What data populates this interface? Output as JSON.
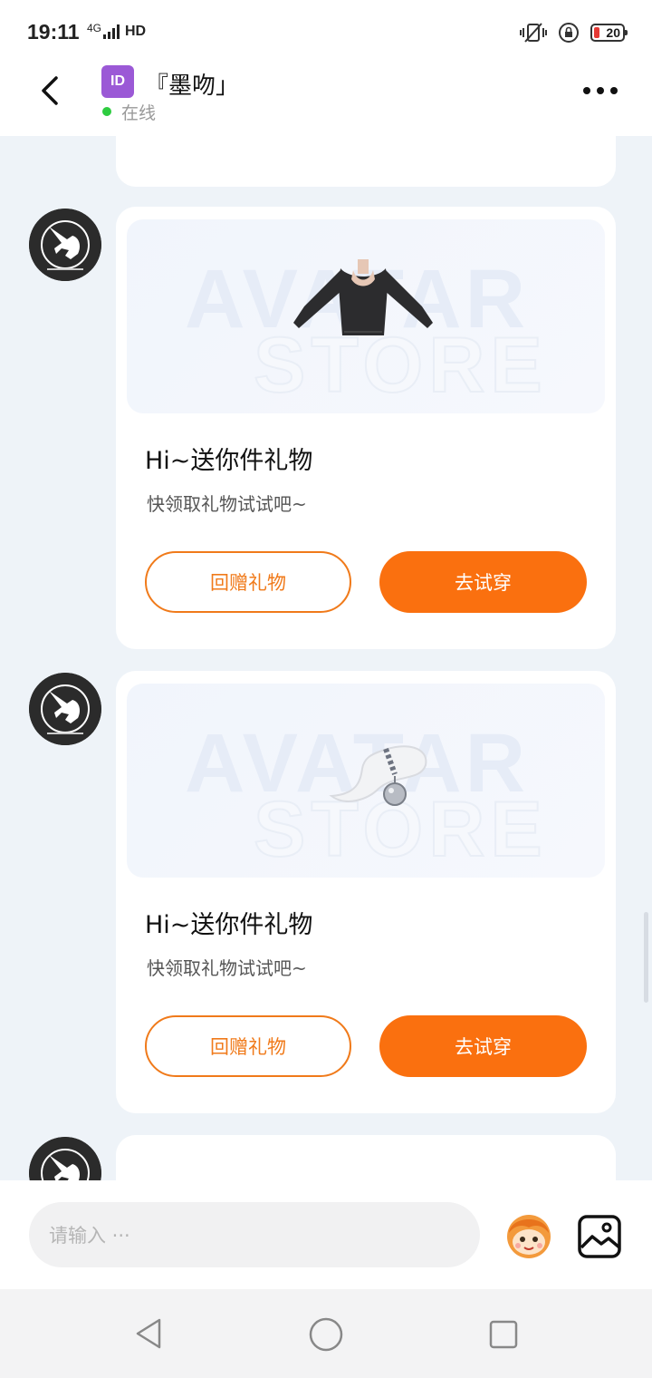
{
  "status_bar": {
    "time": "19:11",
    "network": "4G",
    "hd": "HD",
    "battery": "20",
    "battery_color": "#e53935"
  },
  "header": {
    "id_badge": "ID",
    "contact_name": "『墨吻」",
    "status": "在线",
    "back_icon": "chevron-left-icon",
    "more_icon": "more-dots-icon"
  },
  "messages": [
    {
      "gift_icon": "black-top-gift",
      "watermark_line1": "AVATAR",
      "watermark_line2": "STORE",
      "title": "Hi~送你件礼物",
      "subtitle": "快领取礼物试试吧~",
      "return_gift_label": "回赠礼物",
      "try_on_label": "去试穿"
    },
    {
      "gift_icon": "fluffy-tail-bell-gift",
      "watermark_line1": "AVATAR",
      "watermark_line2": "STORE",
      "title": "Hi~送你件礼物",
      "subtitle": "快领取礼物试试吧~",
      "return_gift_label": "回赠礼物",
      "try_on_label": "去试穿"
    }
  ],
  "input": {
    "placeholder": "请输入 ···",
    "emoji_icon": "sticker-face-icon",
    "image_icon": "image-icon"
  },
  "theme": {
    "accent": "#fa700f",
    "online": "#2ecc40",
    "background": "#eef3f8"
  }
}
